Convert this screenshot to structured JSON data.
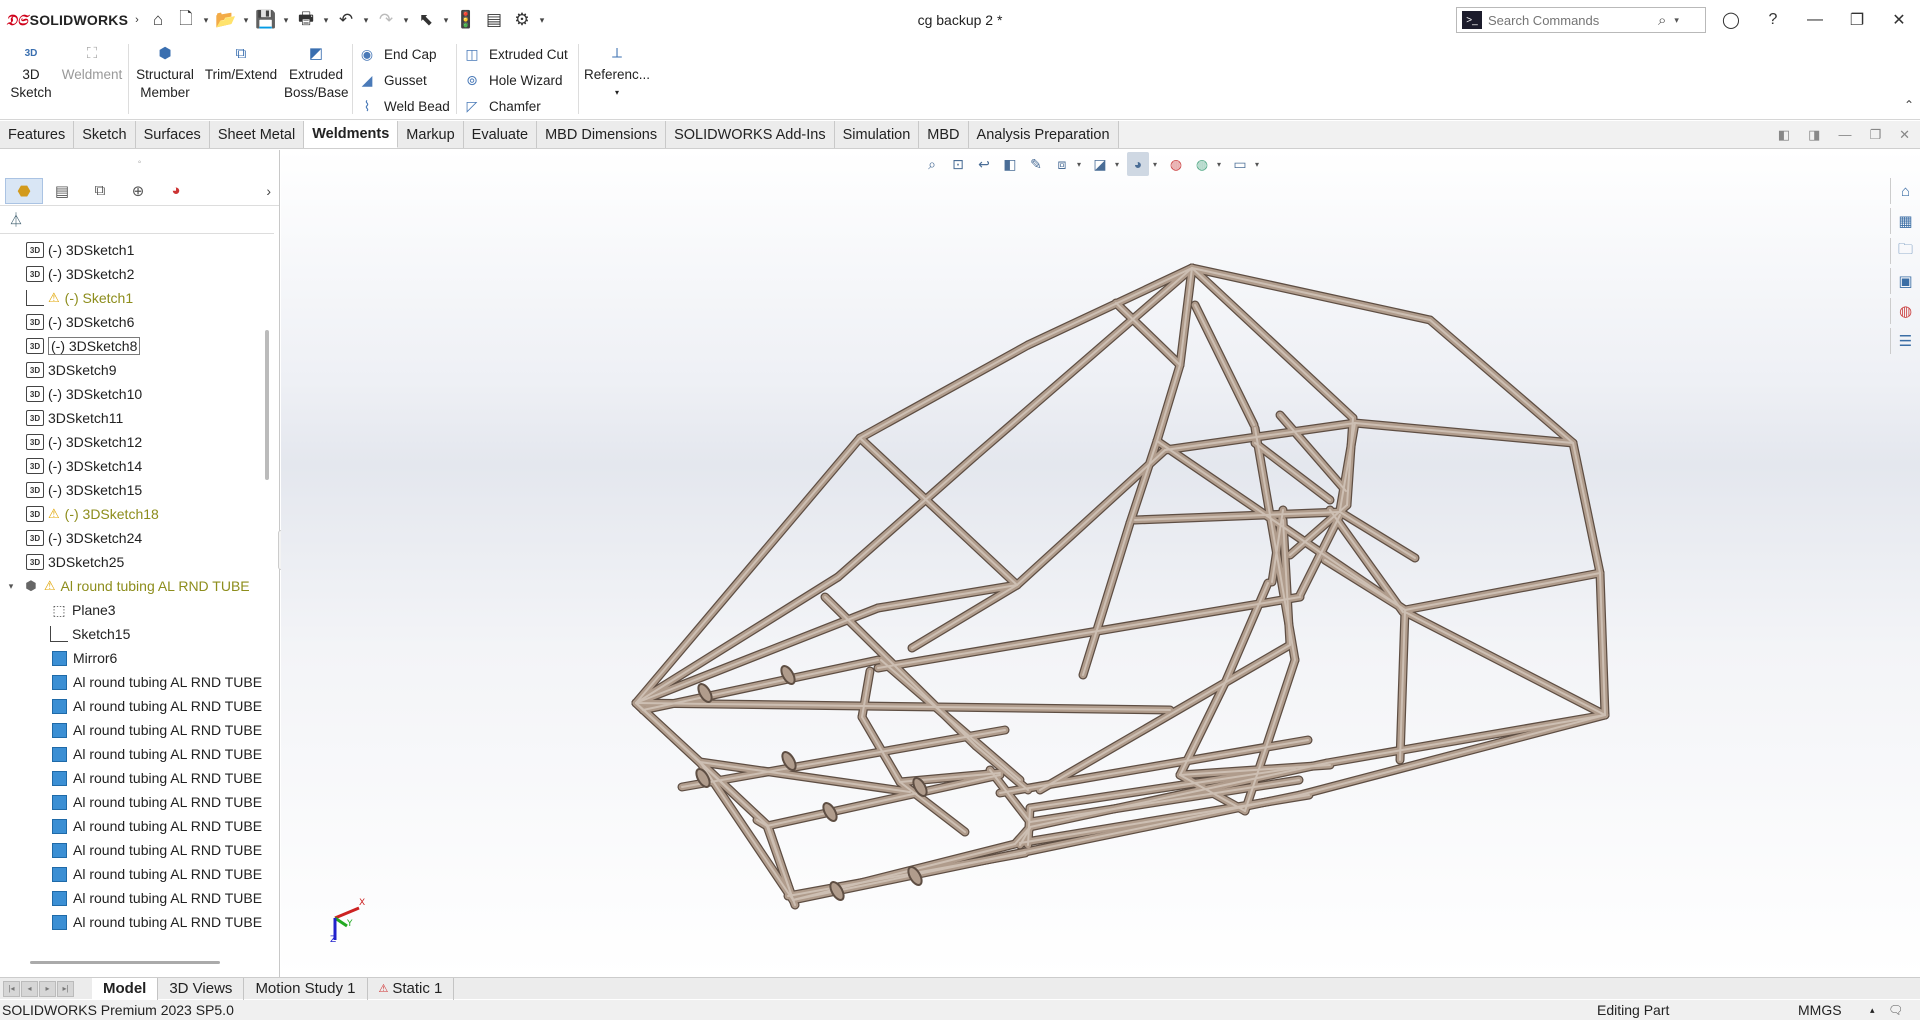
{
  "app": {
    "logo_text": "SOLIDWORKS",
    "document_title": "cg backup 2 *",
    "search_placeholder": "Search Commands"
  },
  "quick_access": [
    "home-icon",
    "new-document-icon",
    "open-icon",
    "save-icon",
    "print-icon",
    "undo-icon",
    "redo-icon",
    "select-icon",
    "rebuild-icon",
    "file-properties-icon",
    "options-icon"
  ],
  "command_manager": {
    "big_buttons": [
      {
        "id": "3d-sketch",
        "label_line1": "3D",
        "label_line2": "Sketch",
        "enabled": true
      },
      {
        "id": "weldment",
        "label_line1": "Weldment",
        "label_line2": "",
        "enabled": false
      },
      {
        "id": "structural-member",
        "label_line1": "Structural",
        "label_line2": "Member",
        "enabled": true
      },
      {
        "id": "trim-extend",
        "label_line1": "Trim/Extend",
        "label_line2": "",
        "enabled": true
      },
      {
        "id": "extruded-boss",
        "label_line1": "Extruded",
        "label_line2": "Boss/Base",
        "enabled": true
      },
      {
        "id": "reference",
        "label_line1": "Referenc...",
        "label_line2": "",
        "enabled": true
      }
    ],
    "small_buttons_col1": [
      "End Cap",
      "Gusset",
      "Weld Bead"
    ],
    "small_buttons_col2": [
      "Extruded Cut",
      "Hole Wizard",
      "Chamfer"
    ]
  },
  "tabs": [
    "Features",
    "Sketch",
    "Surfaces",
    "Sheet Metal",
    "Weldments",
    "Markup",
    "Evaluate",
    "MBD Dimensions",
    "SOLIDWORKS Add-Ins",
    "Simulation",
    "MBD",
    "Analysis Preparation"
  ],
  "active_tab": "Weldments",
  "feature_tree": [
    {
      "icon": "3d",
      "label": "(-) 3DSketch1",
      "warning": false
    },
    {
      "icon": "3d",
      "label": "(-) 3DSketch2",
      "warning": false
    },
    {
      "icon": "sketch",
      "label": "(-) Sketch1",
      "warning": true
    },
    {
      "icon": "3d",
      "label": "(-) 3DSketch6",
      "warning": false
    },
    {
      "icon": "3d",
      "label": "(-) 3DSketch8",
      "warning": false,
      "boxed": true
    },
    {
      "icon": "3d",
      "label": "3DSketch9",
      "warning": false
    },
    {
      "icon": "3d",
      "label": "(-) 3DSketch10",
      "warning": false
    },
    {
      "icon": "3d",
      "label": "3DSketch11",
      "warning": false
    },
    {
      "icon": "3d",
      "label": "(-) 3DSketch12",
      "warning": false
    },
    {
      "icon": "3d",
      "label": "(-) 3DSketch14",
      "warning": false
    },
    {
      "icon": "3d",
      "label": "(-) 3DSketch15",
      "warning": false
    },
    {
      "icon": "3d",
      "label": "(-) 3DSketch18",
      "warning": true
    },
    {
      "icon": "3d",
      "label": "(-) 3DSketch24",
      "warning": false
    },
    {
      "icon": "3d",
      "label": "3DSketch25",
      "warning": false
    },
    {
      "icon": "weld",
      "label": "Al round tubing AL RND TUBE",
      "warning": true,
      "expandable": true
    },
    {
      "icon": "plane",
      "label": "Plane3",
      "warning": false,
      "indent": true
    },
    {
      "icon": "sketch",
      "label": "Sketch15",
      "warning": false,
      "indent": true
    },
    {
      "icon": "body",
      "label": "Mirror6",
      "warning": false,
      "indent": true
    },
    {
      "icon": "body",
      "label": "Al round tubing AL RND TUBE",
      "warning": false,
      "indent": true
    },
    {
      "icon": "body",
      "label": "Al round tubing AL RND TUBE",
      "warning": false,
      "indent": true
    },
    {
      "icon": "body",
      "label": "Al round tubing AL RND TUBE",
      "warning": false,
      "indent": true
    },
    {
      "icon": "body",
      "label": "Al round tubing AL RND TUBE",
      "warning": false,
      "indent": true
    },
    {
      "icon": "body",
      "label": "Al round tubing AL RND TUBE",
      "warning": false,
      "indent": true
    },
    {
      "icon": "body",
      "label": "Al round tubing AL RND TUBE",
      "warning": false,
      "indent": true
    },
    {
      "icon": "body",
      "label": "Al round tubing AL RND TUBE",
      "warning": false,
      "indent": true
    },
    {
      "icon": "body",
      "label": "Al round tubing AL RND TUBE",
      "warning": false,
      "indent": true
    },
    {
      "icon": "body",
      "label": "Al round tubing AL RND TUBE",
      "warning": false,
      "indent": true
    },
    {
      "icon": "body",
      "label": "Al round tubing AL RND TUBE",
      "warning": false,
      "indent": true
    },
    {
      "icon": "body",
      "label": "Al round tubing AL RND TUBE",
      "warning": false,
      "indent": true
    }
  ],
  "triad": {
    "x": "X",
    "y": "Y",
    "z": "Z"
  },
  "bottom_tabs": [
    "Model",
    "3D Views",
    "Motion Study 1",
    "Static 1"
  ],
  "active_bottom_tab": "Model",
  "status": {
    "product": "SOLIDWORKS Premium 2023 SP5.0",
    "mode": "Editing Part",
    "units": "MMGS"
  },
  "colors": {
    "tube": "#b09c8c",
    "tube_edge": "#5e4e43",
    "accent": "#d0021b"
  }
}
